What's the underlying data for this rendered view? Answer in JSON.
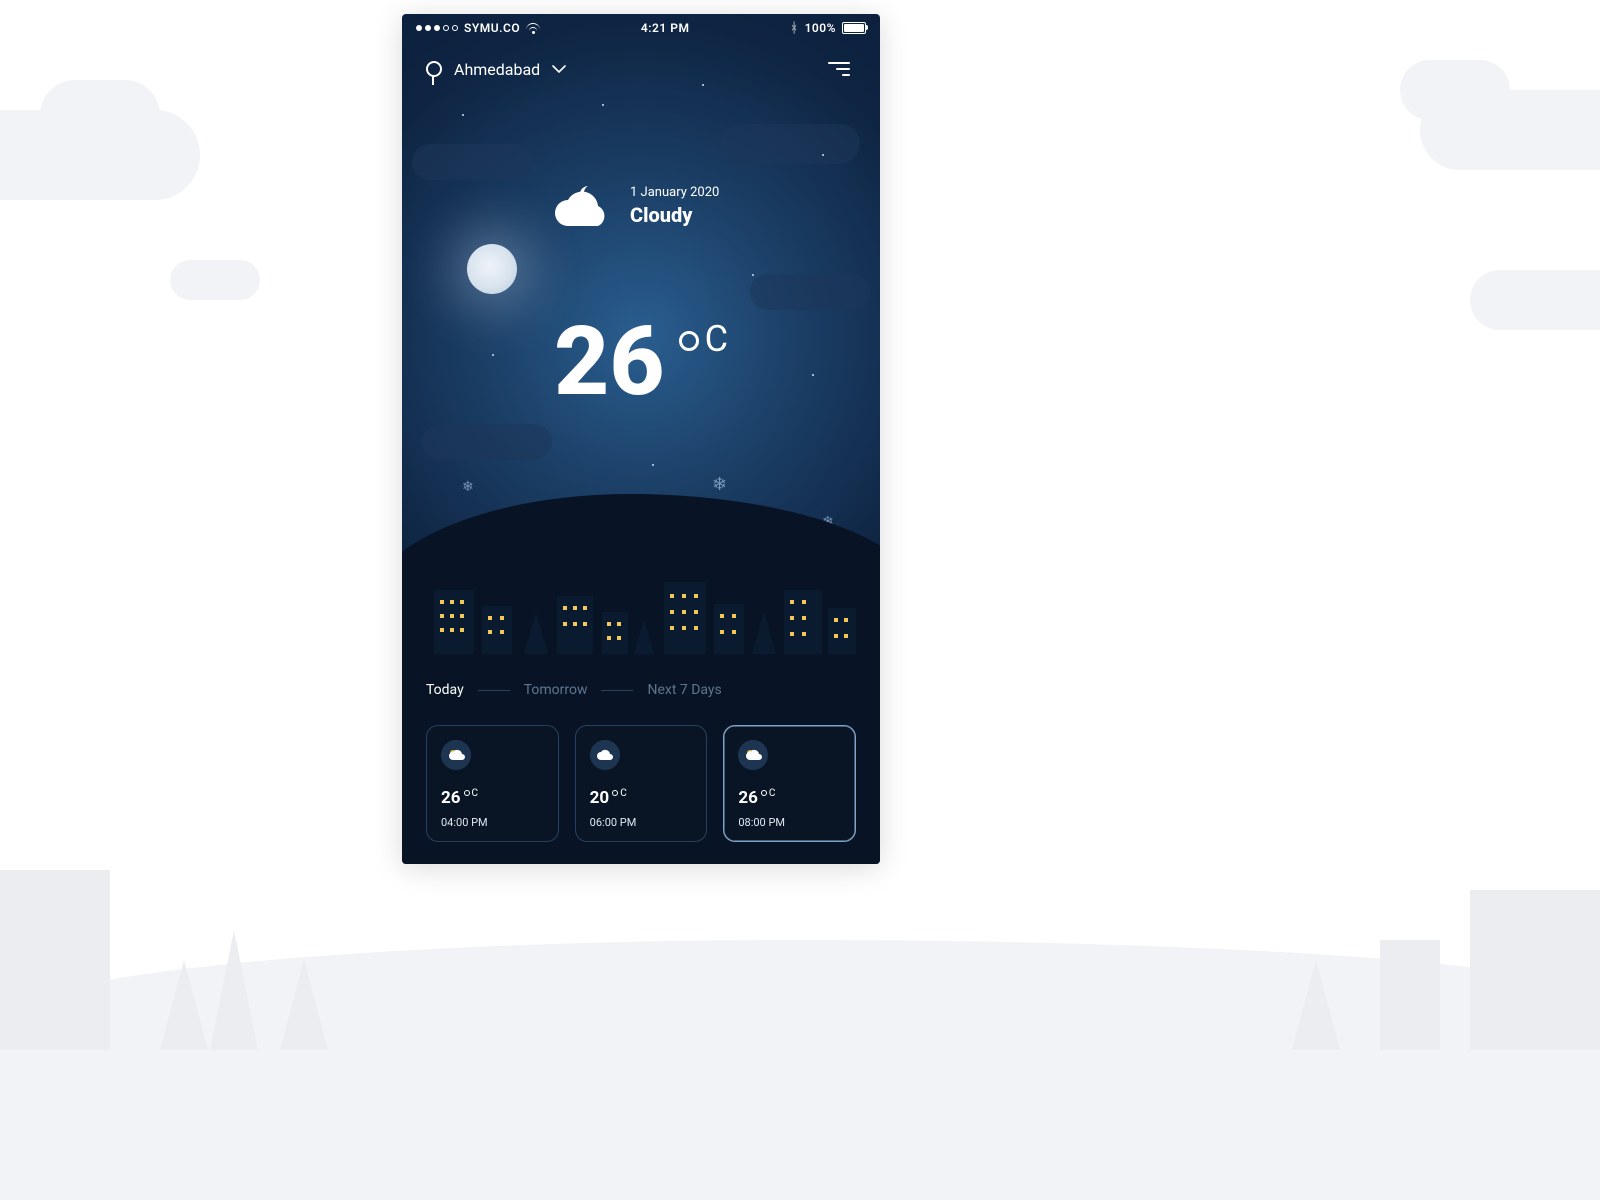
{
  "status": {
    "carrier": "SYMU.CO",
    "time": "4:21 PM",
    "battery": "100%"
  },
  "location": {
    "city": "Ahmedabad"
  },
  "current": {
    "date": "1 January 2020",
    "condition": "Cloudy",
    "temp": "26",
    "unit": "C"
  },
  "tabs": {
    "today": "Today",
    "tomorrow": "Tomorrow",
    "next7": "Next 7 Days"
  },
  "hourly": [
    {
      "icon": "sun-cloud",
      "temp": "26",
      "unit": "C",
      "time": "04:00 PM"
    },
    {
      "icon": "cloud",
      "temp": "20",
      "unit": "C",
      "time": "06:00 PM"
    },
    {
      "icon": "sun-cloud",
      "temp": "26",
      "unit": "C",
      "time": "08:00 PM"
    }
  ]
}
